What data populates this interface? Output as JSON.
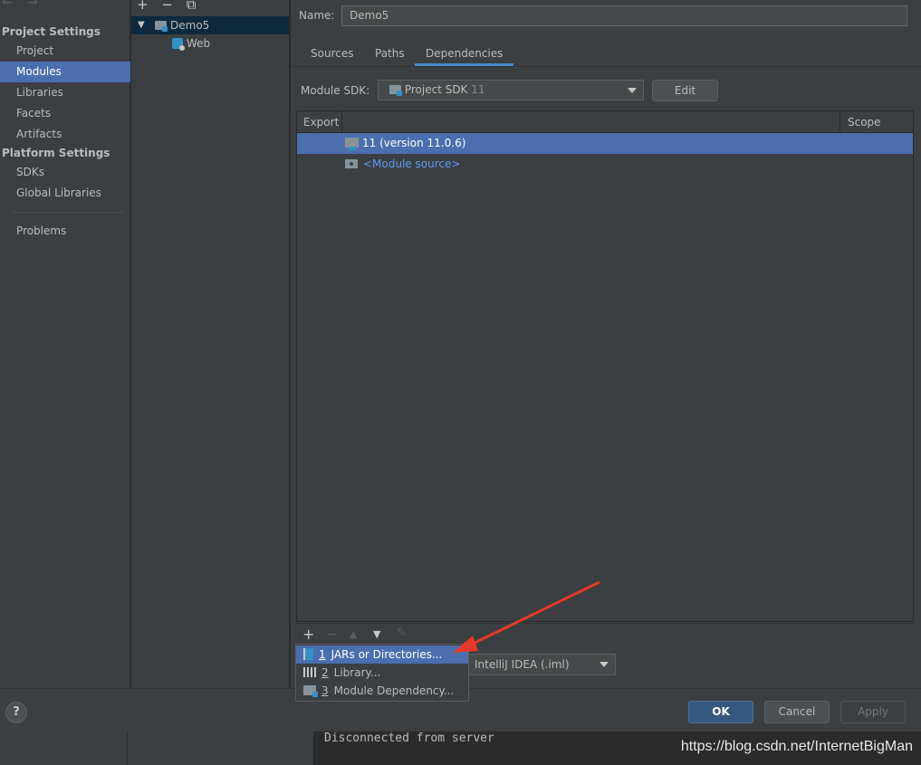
{
  "nav": {
    "arrows": "← →",
    "project_settings": "Project Settings",
    "project": "Project",
    "modules": "Modules",
    "libraries": "Libraries",
    "facets": "Facets",
    "artifacts": "Artifacts",
    "platform_settings": "Platform Settings",
    "sdks": "SDKs",
    "global_libraries": "Global Libraries",
    "problems": "Problems"
  },
  "tree": {
    "add": "+",
    "remove": "−",
    "copy": "⧉",
    "root": "Demo5",
    "child": "Web",
    "icons": [
      "folder-icon",
      "web-icon"
    ]
  },
  "main": {
    "name_label": "Name:",
    "name_value": "Demo5",
    "tabs": [
      "Sources",
      "Paths",
      "Dependencies"
    ],
    "active_tab": "Dependencies",
    "sdk_label": "Module SDK:",
    "sdk_value": "Project SDK",
    "sdk_version": "11",
    "edit_label": "Edit",
    "columns": {
      "export": "Export",
      "scope": "Scope"
    },
    "rows": [
      {
        "label": "11 (version 11.0.6)",
        "icon": "sdk-icon",
        "selected": true
      },
      {
        "label": "<Module source>",
        "icon": "source-folder-icon",
        "selected": false
      }
    ],
    "toolbar": {
      "add": "+",
      "remove": "−",
      "up": "▲",
      "down": "▼",
      "edit": "✎"
    },
    "format_value": "IntelliJ IDEA (.iml)"
  },
  "popup": {
    "items": [
      {
        "num": "1",
        "label": "JARs or Directories...",
        "icon": "jar-icon",
        "selected": true
      },
      {
        "num": "2",
        "label": "Library...",
        "icon": "library-icon",
        "selected": false
      },
      {
        "num": "3",
        "label": "Module Dependency...",
        "icon": "module-icon",
        "selected": false
      }
    ]
  },
  "bottom": {
    "help": "?",
    "ok": "OK",
    "cancel": "Cancel",
    "apply": "Apply"
  },
  "console": {
    "message": "Disconnected from server",
    "watermark": "https://blog.csdn.net/InternetBigMan"
  },
  "colors": {
    "selection": "#4b6eaf",
    "panel": "#3c3f41",
    "link": "#589df6",
    "annotation_arrow": "#e8372c"
  }
}
